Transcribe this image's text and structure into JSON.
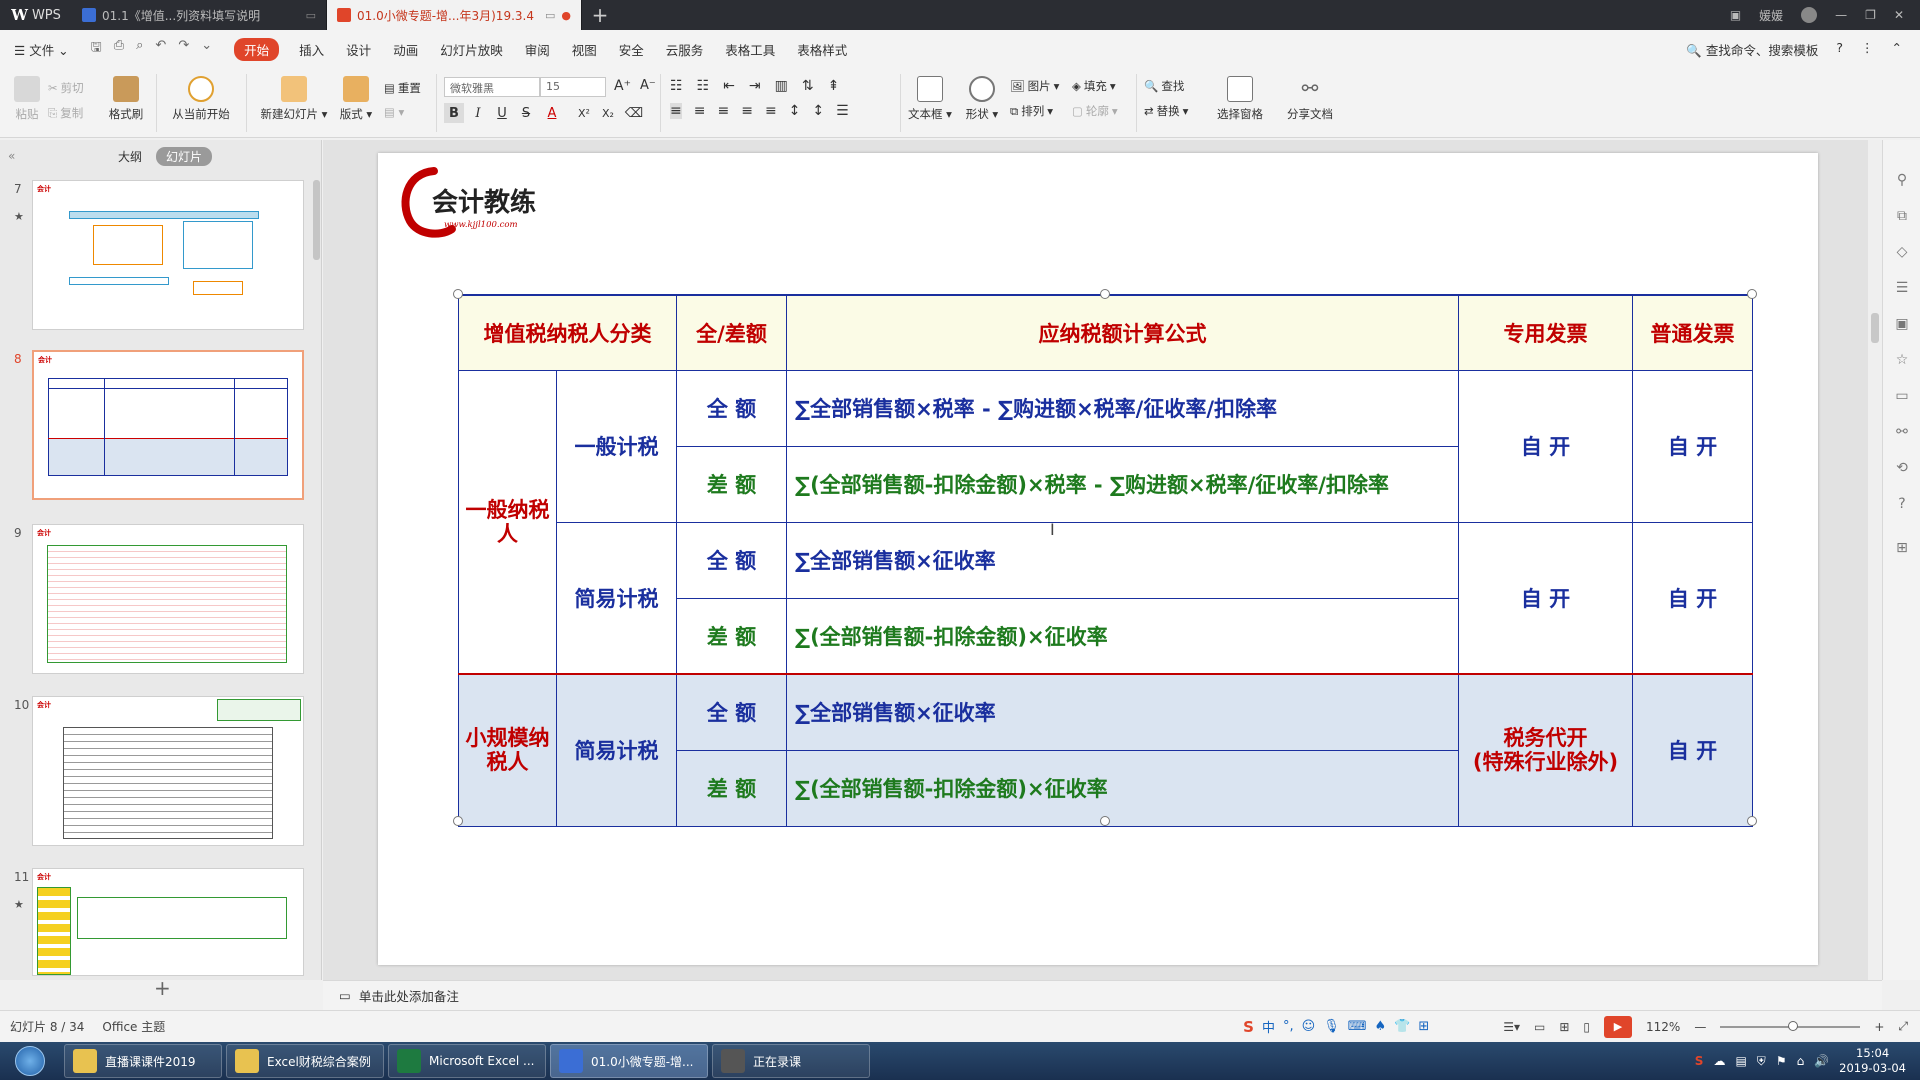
{
  "titlebar": {
    "app_name": "WPS",
    "tabs": [
      {
        "label": "01.1《增值...列资料填写说明",
        "color": "#3b6ed5"
      },
      {
        "label": "01.0小微专题-增...年3月)19.3.4",
        "color": "#e0452a"
      }
    ],
    "user_name": "媛媛"
  },
  "menubar": {
    "file": "文件",
    "items": [
      "插入",
      "设计",
      "动画",
      "幻灯片放映",
      "审阅",
      "视图",
      "安全",
      "云服务",
      "表格工具",
      "表格样式"
    ],
    "start": "开始",
    "search": "查找命令、搜索模板",
    "help": "?"
  },
  "ribbon": {
    "paste": "粘贴",
    "cut": "剪切",
    "copy": "复制",
    "format_painter": "格式刷",
    "play_from_current": "从当前开始",
    "new_slide": "新建幻灯片",
    "layout": "版式",
    "reset": "重置",
    "font_name": "微软雅黑",
    "font_size": "15",
    "text_box": "文本框",
    "shape": "形状",
    "picture": "图片",
    "fill": "填充",
    "arrange": "排列",
    "outline": "轮廓",
    "find": "查找",
    "replace": "替换",
    "select_pane": "选择窗格",
    "share": "分享文档"
  },
  "left_panel": {
    "outline_tab": "大纲",
    "slides_tab": "幻灯片",
    "slides": [
      {
        "num": "7",
        "starred": true
      },
      {
        "num": "8",
        "starred": false,
        "current": true
      },
      {
        "num": "9",
        "starred": false
      },
      {
        "num": "10",
        "starred": false
      },
      {
        "num": "11",
        "starred": true
      }
    ],
    "add": "+"
  },
  "slide": {
    "logo_text": "会计教练",
    "logo_url": "www.kjjl100.com",
    "table": {
      "headers": [
        "增值税纳税人分类",
        "全/差额",
        "应纳税额计算公式",
        "专用发票",
        "普通发票"
      ],
      "general_taxpayer": "一般纳税人",
      "small_taxpayer": "小规模纳税人",
      "general_method": "一般计税",
      "simple_method": "简易计税",
      "full": "全 额",
      "diff": "差 额",
      "f1": "∑全部销售额×税率 - ∑购进额×税率/征收率/扣除率",
      "f2": "∑(全部销售额-扣除金额)×税率 - ∑购进额×税率/征收率/扣除率",
      "f3": "∑全部销售额×征收率",
      "f4": "∑(全部销售额-扣除金额)×征收率",
      "self_issue": "自 开",
      "tax_office_issue": "税务代开",
      "tax_office_note": "(特殊行业除外)"
    }
  },
  "notes": {
    "placeholder": "单击此处添加备注"
  },
  "statusbar": {
    "slide_info": "幻灯片 8 / 34",
    "theme": "Office 主题",
    "zoom": "112%"
  },
  "taskbar": {
    "items": [
      {
        "label": "直播课课件2019",
        "color": "#e8c250"
      },
      {
        "label": "Excel财税综合案例",
        "color": "#e8c250"
      },
      {
        "label": "Microsoft Excel ...",
        "color": "#1e7a40"
      },
      {
        "label": "01.0小微专题-增...",
        "color": "#3b6ed5"
      },
      {
        "label": "正在录课",
        "color": "#555555"
      }
    ],
    "time": "15:04",
    "date": "2019-03-04"
  }
}
